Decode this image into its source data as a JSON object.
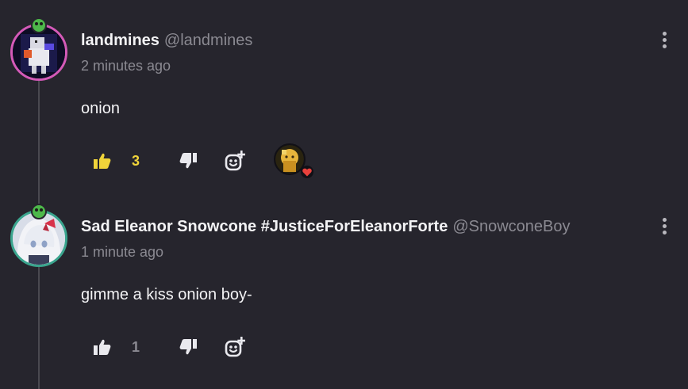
{
  "comments": [
    {
      "author": "landmines",
      "handle": "@landmines",
      "time": "2 minutes ago",
      "body": "onion",
      "likes": "3",
      "liked": true,
      "reactions": [
        {
          "reaction": "heart-icon",
          "color": "#e8413c"
        }
      ]
    },
    {
      "author": "Sad Eleanor Snowcone #JusticeForEleanorForte",
      "handle": "@SnowconeBoy",
      "time": "1 minute ago",
      "body": "gimme a kiss onion boy-",
      "likes": "1",
      "liked": false,
      "reactions": []
    }
  ],
  "colors": {
    "background": "#26252d",
    "liked_accent": "#f0d43a",
    "muted": "#8b8a92",
    "avatar_ring_1": "#d45ab8",
    "avatar_ring_2": "#3aa58e",
    "badge": "#4db84a"
  },
  "icons": {
    "like": "thumbs-up-icon",
    "dislike": "thumbs-down-icon",
    "react": "add-reaction-icon",
    "menu": "kebab-menu-icon"
  }
}
